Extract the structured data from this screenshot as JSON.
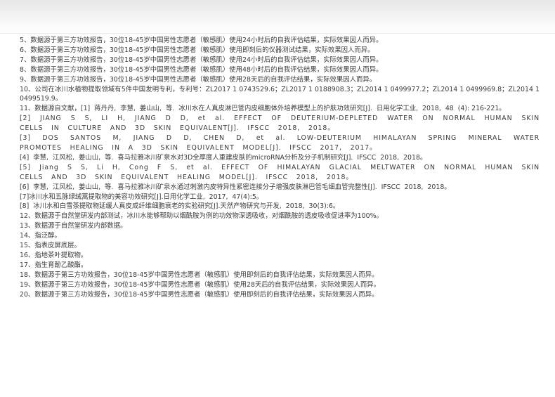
{
  "notes": [
    "5、数据源于第三方功效报告，30位18-45岁中国男性志愿者（敏感肌）使用24小时后的自我评估结果，实际效果因人而异。",
    "6、数据源于第三方功效报告，30位18-45岁中国男性志愿者（敏感肌）使用即刻后的仪器测试结果，实际效果因人而异。",
    "7、数据源于第三方功效报告，30位18-45岁中国男性志愿者（敏感肌）使用24小时后的自我评估结果，实际效果因人而异。",
    "8、数据源于第三方功效报告，30位18-45岁中国男性志愿者（敏感肌）使用48小时后的自我评估结果，实际效果因人而异。",
    "9、数据源于第三方功效报告，30位18-45岁中国男性志愿者（敏感肌）使用28天后的自我评估结果，实际效果因人而异。",
    "10、公司在冰川水植物提取领域有5件中国发明专利，专利号：ZL2017 1 0743529.6；ZL2017 1 0188908.3；ZL2014 1 0499977.2；ZL2014 1 0499969.8；ZL2014 1 0499519.9。",
    "11、数据源自文献，[1]  蒋丹丹,  李慧,  姜山山,  等.  冰川水在人真皮淋巴管内皮细胞体外培养模型上的护肤功效研究[J].  日用化学工业,  2018,  48  (4): 216-221。",
    "[2]  JIANG  S  S,  LI  H,  JIANG  D  D,  et  al.  EFFECT  OF  DEUTERIUM-DEPLETED  WATER  ON  NORMAL  HUMAN  SKIN  CELLS  IN  CULTURE  AND  3D  SKIN  EQUIVALENT[J].  IFSCC  2018,  2018。",
    "[3]  DOS  SANTOS  M,  JIANG  D  D,  CHEN  D,  et  al.  LOW-DEUTERIUM  HIMALAYAN  SPRING  MINERAL  WATER  PROMOTES  HEALING  IN  A  3D  SKIN  EQUIVALENT  MODEL[J].  IFSCC  2017,  2017。",
    "[4]  李慧,  江风松,  姜山山,  等.  喜马拉雅冰川矿泉水对3D全厚度人重建皮肤的microRNA分析及分子机制研究[J].  IFSCC  2018,  2018。",
    "[5]  Jiang  S  S,  Li  H,  Cong  F  S,  et  al.  EFFECT  OF  HIMALAYAN  GLACIAL  MELTWATER  ON  NORMAL  HUMAN  SKIN  CELLS  AND  3D  SKIN  EQUIVALENT  HEALING  MODEL[J].  IFSCC  2018,  2018。",
    "[6]  李慧,  江风松,  姜山山,  等.  喜马拉雅冰川矿泉水通过刺激内皮特异性紧密连接分子增强皮肤淋巴管毛细血管完整性[J].  IFSCC  2018,  2018。",
    "[7]冰川水和五脉绿绒蒿提取物的美容功效研究[J].日用化学工业,  2017,  47(4):5。",
    "[8]  冰川水和白雪茶提取物延缓人真皮成纤维细胞衰老的实验研究[J].天然产物研究与开发,  2018,  30(3):6。",
    "12、数据源于自然堂研发内部测试，冰川水能够帮助以烟酰胺为例的功效物深透吸收，对烟酰胺的透皮吸收促进率为100%。",
    "13、数据源于自然堂研发内部数据。",
    "14、指泛醇。",
    "15、指表皮屏底层。",
    "16、指地茶叶提取物。",
    "17、指生育酚乙酸酯。",
    "18、数据源于第三方功效报告，30位18-45岁中国男性志愿者（敏感肌）使用即刻后的自我评估结果，实际效果因人而异。",
    "19、数据源于第三方功效报告，30位18-45岁中国男性志愿者（敏感肌）使用28天后的自我评估结果，实际效果因人而异。",
    "20、数据源于第三方功效报告，30位18-45岁中国男性志愿者（敏感肌）使用即刻后的自我评估结果，实际效果因人而异。"
  ]
}
